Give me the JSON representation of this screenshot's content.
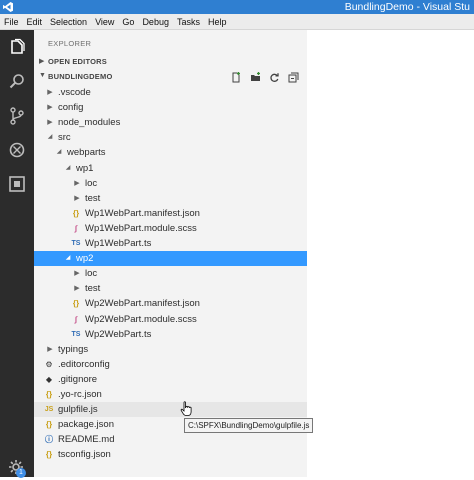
{
  "window": {
    "title": "BundlingDemo - Visual Stu"
  },
  "menu": [
    "File",
    "Edit",
    "Selection",
    "View",
    "Go",
    "Debug",
    "Tasks",
    "Help"
  ],
  "activity_bar": {
    "icons": [
      "explorer-icon",
      "search-icon",
      "source-control-icon",
      "debug-icon",
      "extensions-icon",
      "gear-icon"
    ],
    "gear_badge": "1"
  },
  "explorer": {
    "title": "EXPLORER",
    "open_editors": "OPEN EDITORS",
    "project": "BUNDLINGDEMO",
    "actions": [
      "new-file-icon",
      "new-folder-icon",
      "refresh-icon",
      "collapse-all-icon"
    ],
    "tree": [
      {
        "label": ".vscode",
        "kind": "folder",
        "state": "collapsed",
        "depth": 0
      },
      {
        "label": "config",
        "kind": "folder",
        "state": "collapsed",
        "depth": 0
      },
      {
        "label": "node_modules",
        "kind": "folder",
        "state": "collapsed",
        "depth": 0
      },
      {
        "label": "src",
        "kind": "folder",
        "state": "expanded",
        "depth": 0
      },
      {
        "label": "webparts",
        "kind": "folder",
        "state": "expanded",
        "depth": 1
      },
      {
        "label": "wp1",
        "kind": "folder",
        "state": "expanded",
        "depth": 2
      },
      {
        "label": "loc",
        "kind": "folder",
        "state": "collapsed",
        "depth": 3
      },
      {
        "label": "test",
        "kind": "folder",
        "state": "collapsed",
        "depth": 3
      },
      {
        "label": "Wp1WebPart.manifest.json",
        "kind": "json",
        "depth": 3
      },
      {
        "label": "Wp1WebPart.module.scss",
        "kind": "scss",
        "depth": 3
      },
      {
        "label": "Wp1WebPart.ts",
        "kind": "ts",
        "depth": 3
      },
      {
        "label": "wp2",
        "kind": "folder",
        "state": "expanded",
        "depth": 2,
        "selected": true
      },
      {
        "label": "loc",
        "kind": "folder",
        "state": "collapsed",
        "depth": 3
      },
      {
        "label": "test",
        "kind": "folder",
        "state": "collapsed",
        "depth": 3
      },
      {
        "label": "Wp2WebPart.manifest.json",
        "kind": "json",
        "depth": 3
      },
      {
        "label": "Wp2WebPart.module.scss",
        "kind": "scss",
        "depth": 3
      },
      {
        "label": "Wp2WebPart.ts",
        "kind": "ts",
        "depth": 3
      },
      {
        "label": "typings",
        "kind": "folder",
        "state": "collapsed",
        "depth": 0
      },
      {
        "label": ".editorconfig",
        "kind": "cfg",
        "depth": 0
      },
      {
        "label": ".gitignore",
        "kind": "git",
        "depth": 0
      },
      {
        "label": ".yo-rc.json",
        "kind": "json",
        "depth": 0
      },
      {
        "label": "gulpfile.js",
        "kind": "js",
        "depth": 0,
        "hovered": true
      },
      {
        "label": "package.json",
        "kind": "json",
        "depth": 0
      },
      {
        "label": "README.md",
        "kind": "md",
        "depth": 0
      },
      {
        "label": "tsconfig.json",
        "kind": "json",
        "depth": 0
      }
    ]
  },
  "icon_glyphs": {
    "json": "{}",
    "scss": "∫",
    "ts": "TS",
    "js": "JS",
    "md": "ⓘ",
    "cfg": "⚙",
    "git": "◆"
  },
  "tooltip": "C:\\SPFX\\BundlingDemo\\gulpfile.js"
}
